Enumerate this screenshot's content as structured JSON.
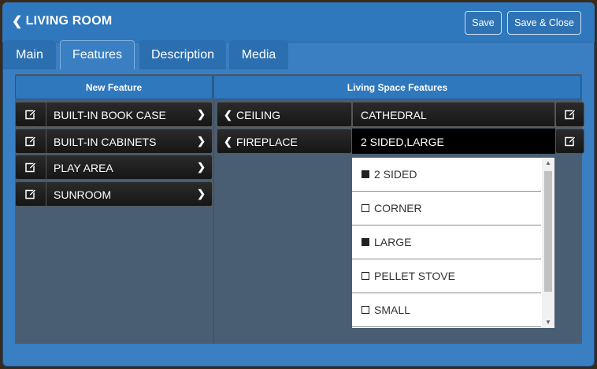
{
  "header": {
    "title": "LIVING ROOM",
    "save_label": "Save",
    "save_close_label": "Save & Close"
  },
  "tabs": [
    {
      "label": "Main",
      "active": false
    },
    {
      "label": "Features",
      "active": true
    },
    {
      "label": "Description",
      "active": false
    },
    {
      "label": "Media",
      "active": false
    }
  ],
  "columns": {
    "new_feature": "New Feature",
    "living_space": "Living Space Features"
  },
  "new_features": [
    {
      "label": "BUILT-IN BOOK CASE"
    },
    {
      "label": "BUILT-IN CABINETS"
    },
    {
      "label": "PLAY AREA"
    },
    {
      "label": "SUNROOM"
    }
  ],
  "living_space_features": [
    {
      "name": "CEILING",
      "value": "CATHEDRAL"
    },
    {
      "name": "FIREPLACE",
      "value": "2 SIDED,LARGE"
    }
  ],
  "dropdown_options": [
    {
      "label": "2 SIDED",
      "checked": true
    },
    {
      "label": "CORNER",
      "checked": false
    },
    {
      "label": "LARGE",
      "checked": true
    },
    {
      "label": "PELLET STOVE",
      "checked": false
    },
    {
      "label": "SMALL",
      "checked": false
    }
  ],
  "icons": {
    "back": "chevron-left-icon",
    "edit": "edit-icon",
    "row_arrow": "chevron-right-icon",
    "feature_arrow": "chevron-left-icon"
  },
  "colors": {
    "accent": "#2f78be",
    "panel": "#4a5e73",
    "row": "#1e1e1e"
  }
}
